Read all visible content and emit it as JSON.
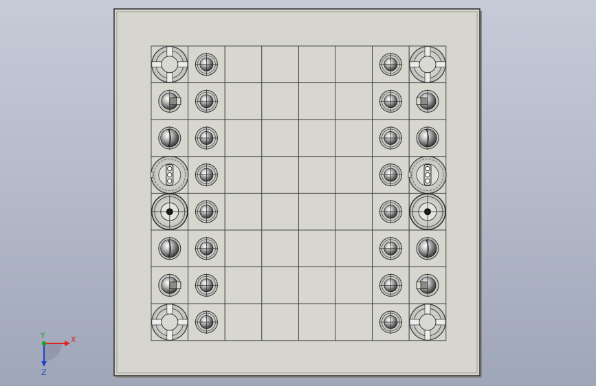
{
  "scene": {
    "background_top": "#c6cbd8",
    "background_bottom": "#9fa6b8",
    "board_color": "#d6d6ce",
    "edge_color": "#2b2b2b"
  },
  "board": {
    "rows": 8,
    "cols": 8,
    "left_pieces": [
      "rook",
      "knight",
      "bishop",
      "queen",
      "king",
      "bishop",
      "knight",
      "rook"
    ],
    "right_pieces": [
      "rook",
      "knight",
      "bishop",
      "queen",
      "king",
      "bishop",
      "knight",
      "rook"
    ],
    "pawn_columns": [
      1,
      6
    ],
    "piece_columns": [
      0,
      7
    ]
  },
  "triad": {
    "x_label": "X",
    "y_label": "Y",
    "z_label": "Z",
    "x_color": "#e02020",
    "y_color": "#20a020",
    "z_color": "#2040d0"
  }
}
